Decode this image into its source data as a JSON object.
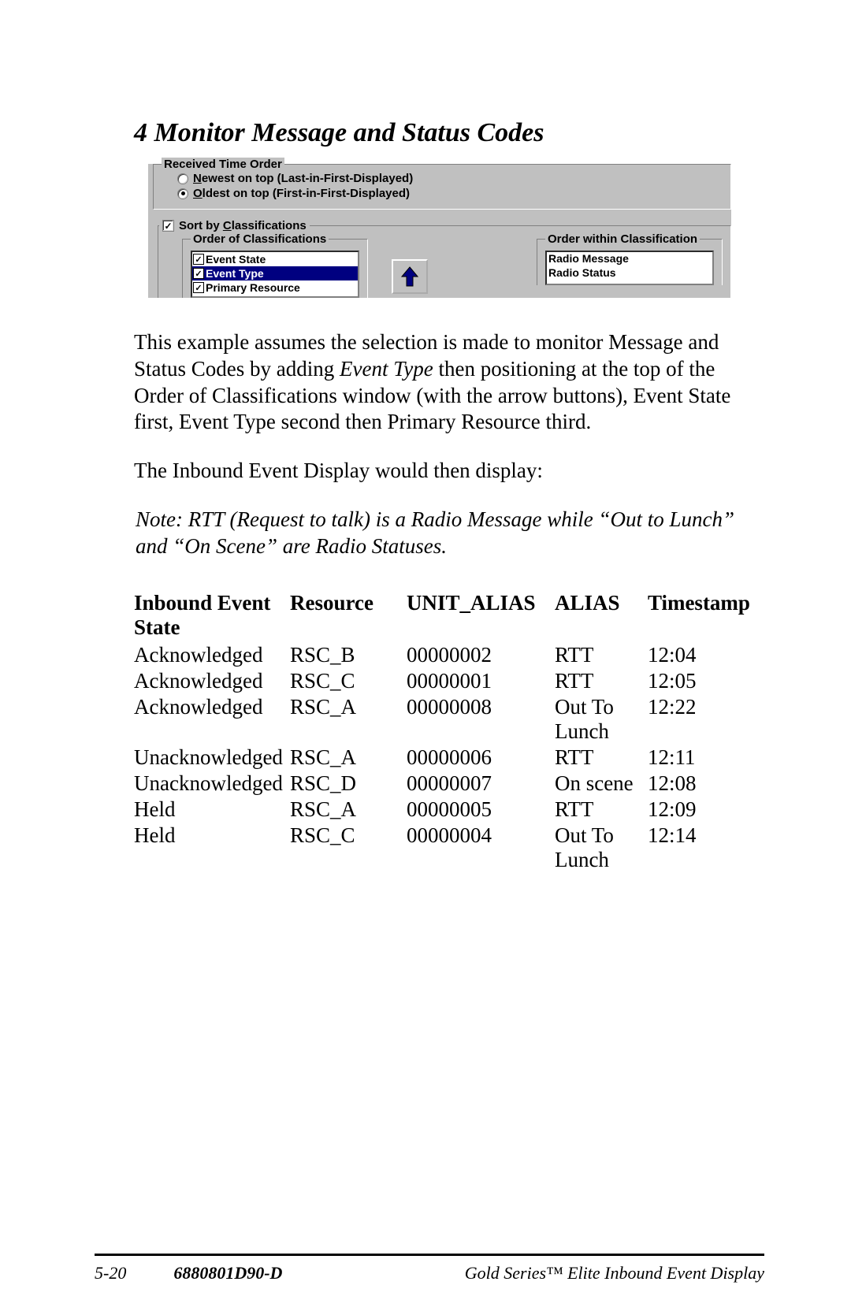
{
  "heading": "4  Monitor Message and Status Codes",
  "ui": {
    "received_time_order_title": "Received Time Order",
    "radio_newest_pre": "N",
    "radio_newest_post": "ewest on top (Last-in-First-Displayed)",
    "radio_oldest_pre": "O",
    "radio_oldest_post": "ldest on top (First-in-First-Displayed)",
    "sort_by_pre": "Sort by ",
    "sort_by_u": "C",
    "sort_by_post": "lassifications",
    "order_of_cls_title": "Order of Classifications",
    "order_within_title": "Order within Classification",
    "cls_items": [
      {
        "label": "Event State",
        "checked": true,
        "selected": false
      },
      {
        "label": "Event Type",
        "checked": true,
        "selected": true
      },
      {
        "label": "Primary Resource",
        "checked": true,
        "selected": false
      }
    ],
    "within_items": [
      "Radio Message",
      "Radio Status"
    ]
  },
  "para1_parts": {
    "a": "This example assumes the selection is made to monitor Message and Status Codes by adding ",
    "b": "Event Type",
    "c": " then positioning at the top of the Order of Classifications window (with the arrow buttons), Event State first,  Event Type second then Primary Resource third."
  },
  "para2": "The Inbound Event Display would then display:",
  "note": "Note:  RTT (Request to talk)  is a Radio Message while “Out to Lunch” and “On Scene” are Radio Statuses.",
  "table": {
    "headers": [
      "Inbound Event State",
      "Resource",
      "UNIT_ALIAS",
      "ALIAS",
      "Timestamp"
    ],
    "rows": [
      [
        "Acknowledged",
        "RSC_B",
        "00000002",
        "RTT",
        "12:04"
      ],
      [
        "Acknowledged",
        "RSC_C",
        "00000001",
        "RTT",
        "12:05"
      ],
      [
        "Acknowledged",
        "RSC_A",
        "00000008",
        "Out To Lunch",
        "12:22"
      ],
      [
        "Unacknowledged",
        "RSC_A",
        "00000006",
        "RTT",
        "12:11"
      ],
      [
        "Unacknowledged",
        "RSC_D",
        "00000007",
        "On scene",
        "12:08"
      ],
      [
        "Held",
        "RSC_A",
        "00000005",
        "RTT",
        "12:09"
      ],
      [
        "Held",
        "RSC_C",
        "00000004",
        "Out To Lunch",
        "12:14"
      ]
    ]
  },
  "footer": {
    "page": "5-20",
    "doc": "6880801D90-D",
    "title": "Gold Series™ Elite Inbound Event Display"
  }
}
